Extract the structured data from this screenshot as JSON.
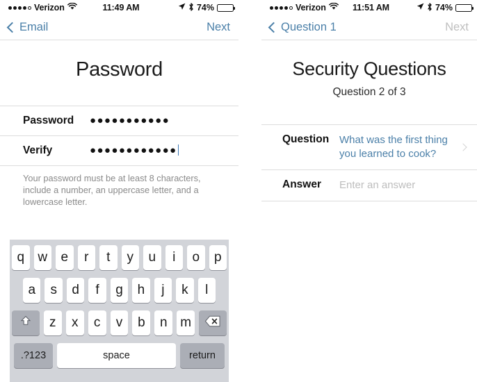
{
  "left_phone": {
    "status_bar": {
      "signal_dots_filled": 4,
      "signal_dots_total": 5,
      "carrier": "Verizon",
      "wifi_icon": "wifi-icon",
      "time": "11:49 AM",
      "location_icon": "location-arrow-icon",
      "bluetooth_icon": "bluetooth-icon",
      "battery_percent": "74%",
      "battery_level": 74
    },
    "nav": {
      "back_label": "Email",
      "back_icon": "chevron-left-icon",
      "next_label": "Next",
      "next_disabled": false
    },
    "title": "Password",
    "fields": [
      {
        "label": "Password",
        "value": "●●●●●●●●●●●",
        "dots": 11,
        "focused": false
      },
      {
        "label": "Verify",
        "value": "●●●●●●●●●●●●",
        "dots": 12,
        "focused": true
      }
    ],
    "hint": "Your password must be at least 8 characters, include a number, an uppercase letter, and a lowercase letter.",
    "keyboard": {
      "row1": [
        "q",
        "w",
        "e",
        "r",
        "t",
        "y",
        "u",
        "i",
        "o",
        "p"
      ],
      "row2": [
        "a",
        "s",
        "d",
        "f",
        "g",
        "h",
        "j",
        "k",
        "l"
      ],
      "row3": [
        "z",
        "x",
        "c",
        "v",
        "b",
        "n",
        "m"
      ],
      "shift_icon": "shift-icon",
      "delete_icon": "delete-backspace-icon",
      "numbers_label": ".?123",
      "space_label": "space",
      "return_label": "return"
    }
  },
  "right_phone": {
    "status_bar": {
      "signal_dots_filled": 4,
      "signal_dots_total": 5,
      "carrier": "Verizon",
      "wifi_icon": "wifi-icon",
      "time": "11:51 AM",
      "location_icon": "location-arrow-icon",
      "bluetooth_icon": "bluetooth-icon",
      "battery_percent": "74%",
      "battery_level": 74
    },
    "nav": {
      "back_label": "Question 1",
      "back_icon": "chevron-left-icon",
      "next_label": "Next",
      "next_disabled": true
    },
    "title": "Security Questions",
    "subtitle": "Question 2 of 3",
    "rows": [
      {
        "label": "Question",
        "value": "What was the first thing you learned to cook?",
        "type": "link",
        "disclosure": true
      },
      {
        "label": "Answer",
        "placeholder": "Enter an answer",
        "type": "input",
        "disclosure": false
      }
    ]
  },
  "colors": {
    "accent_blue": "#4a7fa8",
    "disabled_gray": "#bfbfbf",
    "keyboard_bg": "#d2d4d9",
    "key_white": "#ffffff",
    "key_dark": "#abaeb6",
    "placeholder_gray": "#bdbdbd",
    "hint_gray": "#8a8a8a"
  }
}
